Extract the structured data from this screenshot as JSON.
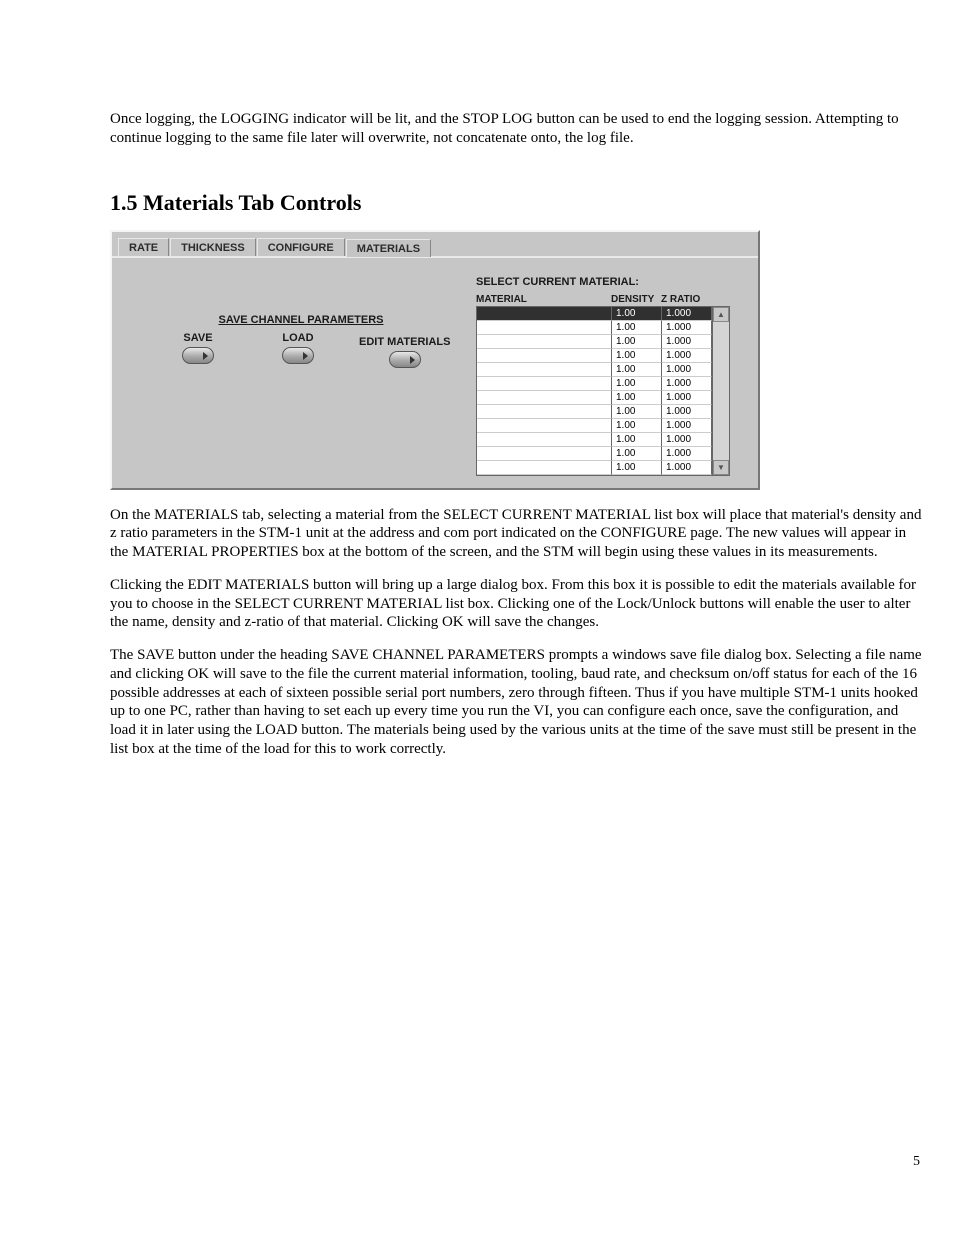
{
  "intro_para": "Once logging, the LOGGING indicator will be lit, and the STOP LOG button can be used to end the logging session.  Attempting to continue logging to the same file later will overwrite, not concatenate onto, the log file.",
  "heading": "1.5 Materials Tab Controls",
  "tabs": {
    "rate": "RATE",
    "thickness": "THICKNESS",
    "configure": "CONFIGURE",
    "materials": "MATERIALS"
  },
  "left": {
    "scp_heading": "SAVE CHANNEL PARAMETERS",
    "save": "SAVE",
    "load": "LOAD",
    "edit": "EDIT MATERIALS"
  },
  "right": {
    "title": "SELECT CURRENT MATERIAL:",
    "col_material": "MATERIAL",
    "col_density": "DENSITY",
    "col_zratio": "Z RATIO",
    "rows": [
      {
        "material": "",
        "density": "1.00",
        "zratio": "1.000"
      },
      {
        "material": "",
        "density": "1.00",
        "zratio": "1.000"
      },
      {
        "material": "",
        "density": "1.00",
        "zratio": "1.000"
      },
      {
        "material": "",
        "density": "1.00",
        "zratio": "1.000"
      },
      {
        "material": "",
        "density": "1.00",
        "zratio": "1.000"
      },
      {
        "material": "",
        "density": "1.00",
        "zratio": "1.000"
      },
      {
        "material": "",
        "density": "1.00",
        "zratio": "1.000"
      },
      {
        "material": "",
        "density": "1.00",
        "zratio": "1.000"
      },
      {
        "material": "",
        "density": "1.00",
        "zratio": "1.000"
      },
      {
        "material": "",
        "density": "1.00",
        "zratio": "1.000"
      },
      {
        "material": "",
        "density": "1.00",
        "zratio": "1.000"
      },
      {
        "material": "",
        "density": "1.00",
        "zratio": "1.000"
      }
    ]
  },
  "para1": "On the MATERIALS tab, selecting a material from the SELECT CURRENT MATERIAL list box will place that material's density and z ratio parameters in the STM-1 unit at the address and com port indicated on the CONFIGURE page.  The new values will appear in the MATERIAL PROPERTIES box at the bottom of the screen, and the STM will begin using these values in its measurements.",
  "para2": "Clicking the EDIT MATERIALS button will bring up a large dialog box.  From this box it is possible to edit the materials available for you to choose in the SELECT CURRENT MATERIAL list box.  Clicking one of the Lock/Unlock buttons will enable the user to alter the name, density and z-ratio of that material.  Clicking OK will save the changes.",
  "para3": "The SAVE button under the heading SAVE CHANNEL PARAMETERS prompts a windows save file dialog box.  Selecting a file name and clicking OK will save to the file the current material information, tooling, baud rate, and checksum on/off status for each of the 16 possible addresses at each of sixteen possible serial port numbers, zero through fifteen.  Thus if you have multiple STM-1 units hooked up to one PC, rather than having to set each up every time you run the VI, you can configure each once, save the configuration, and load it in later using the LOAD button.  The materials being used by the various units at the time of the save must still be present in the list box at the time of the load for this to work correctly.",
  "page_number": "5"
}
